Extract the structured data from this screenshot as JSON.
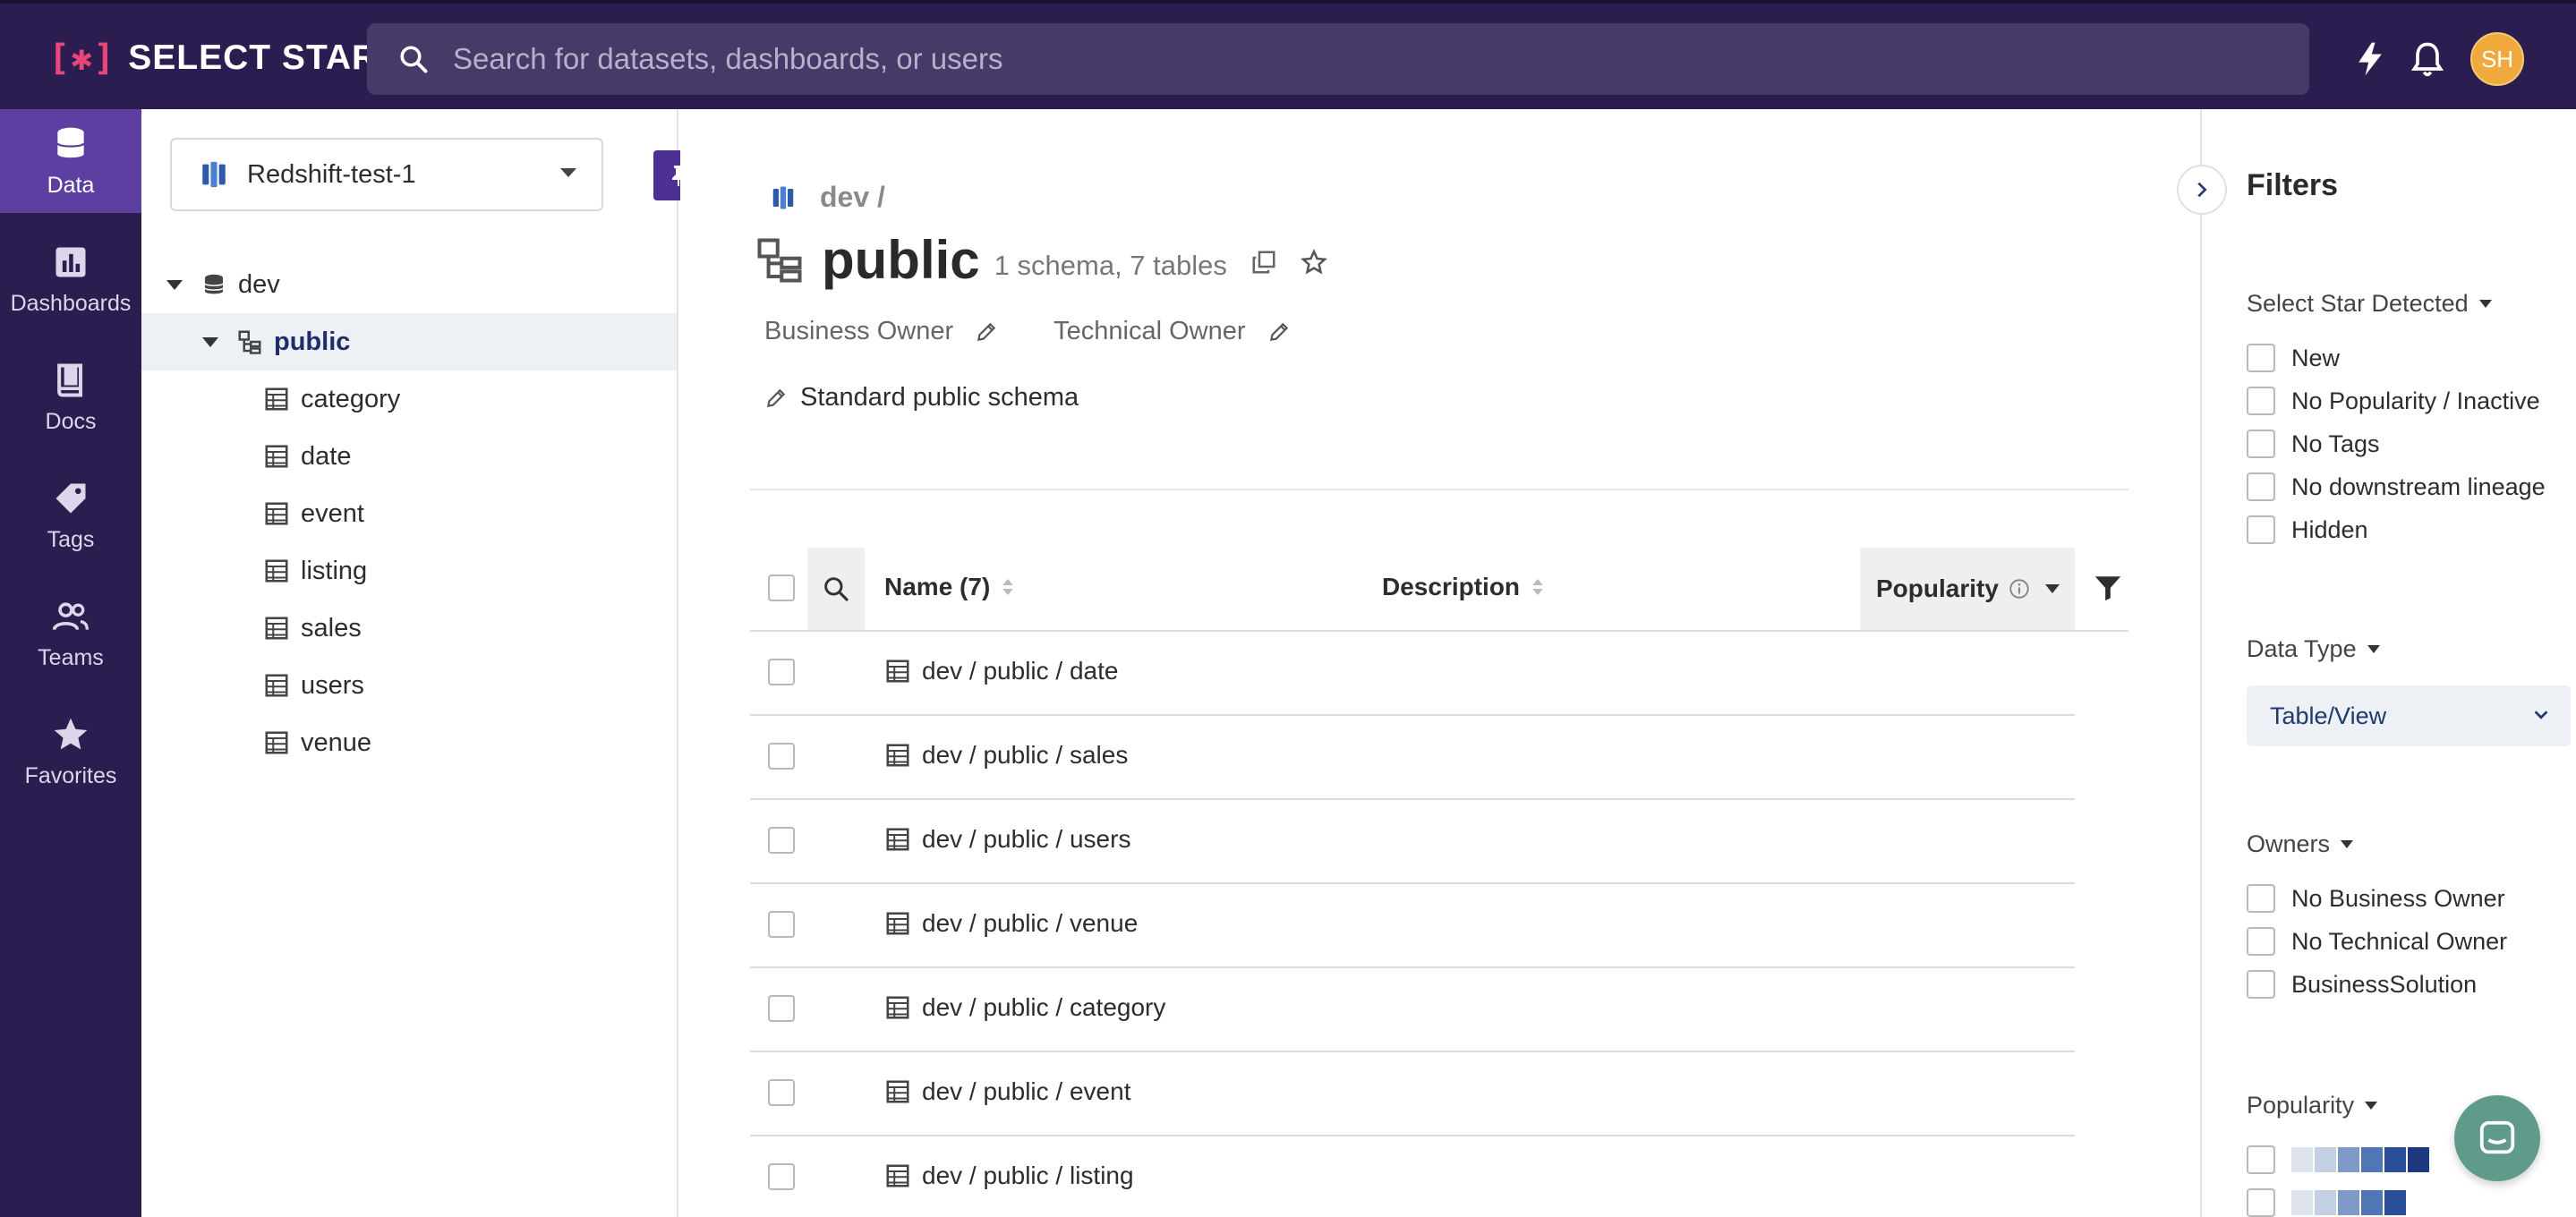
{
  "app": {
    "logo_text": "SELECT STAR",
    "logo_mark": "[✱]"
  },
  "search": {
    "placeholder": "Search for datasets, dashboards, or users"
  },
  "topbar": {
    "avatar_initials": "SH",
    "icons": [
      "lightning-icon",
      "bell-icon"
    ]
  },
  "nav": {
    "items": [
      {
        "label": "Data",
        "icon": "database-icon",
        "active": true
      },
      {
        "label": "Dashboards",
        "icon": "bar-chart-icon",
        "active": false
      },
      {
        "label": "Docs",
        "icon": "book-icon",
        "active": false
      },
      {
        "label": "Tags",
        "icon": "tag-icon",
        "active": false
      },
      {
        "label": "Teams",
        "icon": "people-icon",
        "active": false
      },
      {
        "label": "Favorites",
        "icon": "star-icon",
        "active": false
      }
    ]
  },
  "tree": {
    "datasource": "Redshift-test-1",
    "database": "dev",
    "schema": "public",
    "tables": [
      "category",
      "date",
      "event",
      "listing",
      "sales",
      "users",
      "venue"
    ]
  },
  "main": {
    "breadcrumb": "dev /",
    "title": "public",
    "subtitle": "1 schema, 7 tables",
    "business_owner_label": "Business Owner",
    "technical_owner_label": "Technical Owner",
    "description": "Standard public schema",
    "columns": {
      "name": "Name (7)",
      "description": "Description",
      "popularity": "Popularity"
    },
    "rows": [
      "dev / public / date",
      "dev / public / sales",
      "dev / public / users",
      "dev / public / venue",
      "dev / public / category",
      "dev / public / event",
      "dev / public / listing"
    ]
  },
  "filters": {
    "title": "Filters",
    "detected": {
      "heading": "Select Star Detected",
      "options": [
        "New",
        "No Popularity / Inactive",
        "No Tags",
        "No downstream lineage",
        "Hidden"
      ]
    },
    "data_type": {
      "heading": "Data Type",
      "selected": "Table/View"
    },
    "owners": {
      "heading": "Owners",
      "options": [
        "No Business Owner",
        "No Technical Owner",
        "BusinessSolution"
      ]
    },
    "popularity": {
      "heading": "Popularity",
      "levels": [
        6,
        5
      ]
    }
  },
  "colors": {
    "brand": "#2b1d4f",
    "accent": "#5c3fa0",
    "pin": "#4e2f93",
    "chat": "#5e9b8b"
  }
}
